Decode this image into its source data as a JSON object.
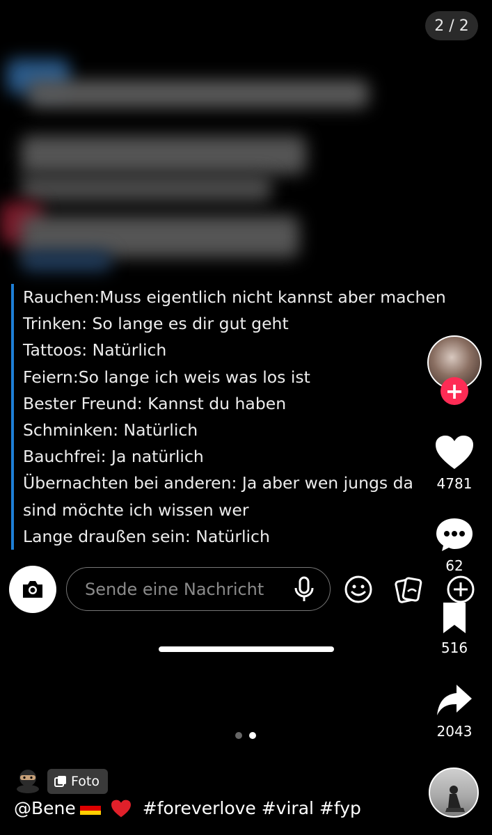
{
  "slide_counter": "2 / 2",
  "chat_lines": [
    "Rauchen:Muss eigentlich nicht kannst aber machen",
    "Trinken: So lange es dir gut geht",
    "Tattoos: Natürlich",
    "Feiern:So lange ich weis was los ist",
    "Bester Freund: Kannst du haben",
    "Schminken: Natürlich",
    "Bauchfrei: Ja natürlich",
    "Übernachten bei anderen: Ja aber wen jungs da",
    "sind möchte ich wissen wer",
    "Lange draußen sein: Natürlich"
  ],
  "message_input": {
    "placeholder": "Sende eine Nachricht"
  },
  "actions": {
    "likes": "4781",
    "comments": "62",
    "bookmarks": "516",
    "shares": "2043"
  },
  "pagination": {
    "total": 2,
    "active": 2
  },
  "post": {
    "type_badge": "Foto",
    "username": "@Bene",
    "hashtags": "#foreverlove #viral #fyp"
  },
  "colors": {
    "accent_red": "#fe2c55",
    "chat_border": "#1e7fd6",
    "background": "#000000"
  }
}
